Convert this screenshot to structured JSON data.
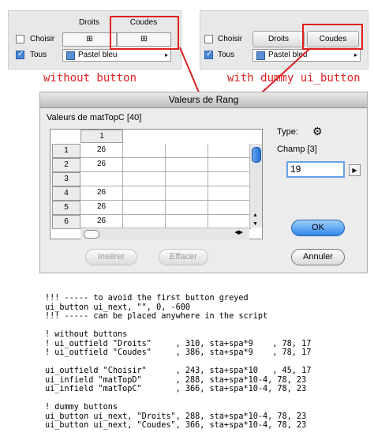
{
  "left_panel": {
    "header_droits": "Droits",
    "header_coudes": "Coudes",
    "cell_droits": "⊞",
    "cell_coudes": "⊞",
    "choisir_label": "Choisir",
    "tous_label": "Tous",
    "color_popup": "Pastel bleu",
    "caption": "without button"
  },
  "right_panel": {
    "choisir_label": "Choisir",
    "tous_label": "Tous",
    "button_droits": "Droits",
    "button_coudes": "Coudes",
    "color_popup": "Pastel bleu",
    "caption": "with dummy ui_button"
  },
  "dialog": {
    "title": "Valeurs de Rang",
    "subtitle": "Valeurs de matTopC [40]",
    "column_header": "1",
    "rows": [
      {
        "num": "1",
        "value": "26"
      },
      {
        "num": "2",
        "value": "26"
      },
      {
        "num": "3",
        "value": ""
      },
      {
        "num": "4",
        "value": "26"
      },
      {
        "num": "5",
        "value": "26"
      },
      {
        "num": "6",
        "value": "26"
      }
    ],
    "type_label": "Type:",
    "champ_label": "Champ [3]",
    "champ_value": "19",
    "ok": "OK",
    "inserer": "Insérer",
    "effacer": "Effacer",
    "annuler": "Annuler"
  },
  "code_lines": [
    "!!! ----- to avoid the first button greyed",
    "ui_button ui_next, \"\", 0, -600",
    "!!! ----- can be placed anywhere in the script",
    "",
    "! without buttons",
    "! ui_outfield \"Droits\"     , 310, sta+spa*9    , 78, 17",
    "! ui_outfield \"Coudes\"     , 386, sta+spa*9    , 78, 17",
    "",
    "ui_outfield \"Choisir\"      , 243, sta+spa*10   , 45, 17",
    "ui_infield \"matTopD\"       , 288, sta+spa*10-4, 78, 23",
    "ui_infield \"matTopC\"       , 366, sta+spa*10-4, 78, 23",
    "",
    "! dummy buttons",
    "ui_button ui_next, \"Droits\", 288, sta+spa*10-4, 78, 23",
    "ui_button ui_next, \"Coudes\", 366, sta+spa*10-4, 78, 23"
  ],
  "colors": {
    "accent_red": "#e02020",
    "ok_blue": "#2f86e8",
    "swatch": "#5a8fd6"
  }
}
